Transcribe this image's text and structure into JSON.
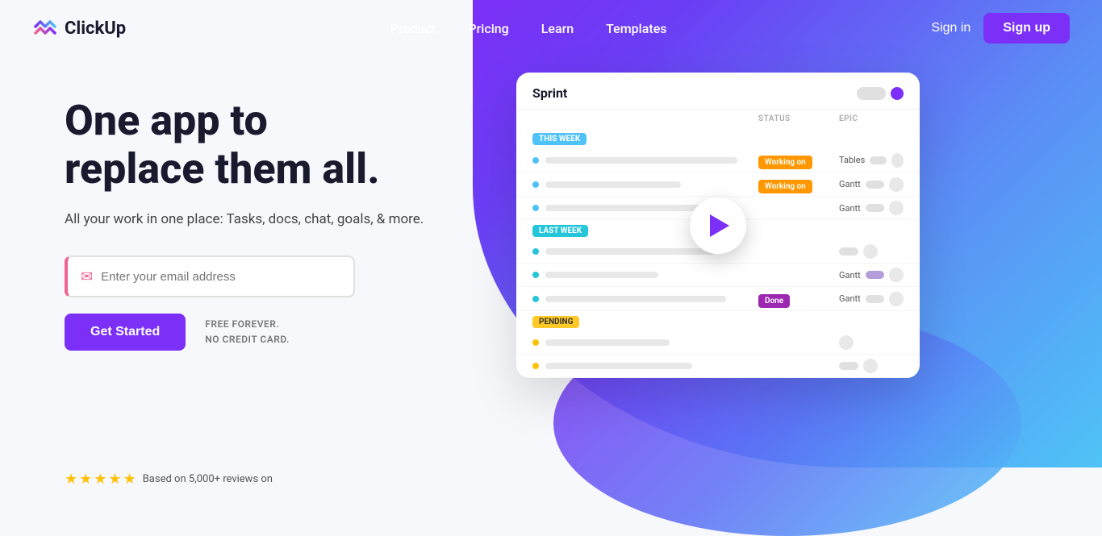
{
  "logo": {
    "text": "ClickUp"
  },
  "nav": {
    "links": [
      {
        "label": "Product",
        "id": "product"
      },
      {
        "label": "Pricing",
        "id": "pricing"
      },
      {
        "label": "Learn",
        "id": "learn"
      },
      {
        "label": "Templates",
        "id": "templates"
      }
    ],
    "sign_in": "Sign in",
    "sign_up": "Sign up"
  },
  "hero": {
    "title_line1": "One app to",
    "title_line2": "replace them all.",
    "subtitle": "All your work in one place: Tasks, docs, chat, goals, & more.",
    "email_placeholder": "Enter your email address",
    "cta_button": "Get Started",
    "free_text_line1": "FREE FOREVER.",
    "free_text_line2": "NO CREDIT CARD."
  },
  "dashboard": {
    "title": "Sprint",
    "col_status": "STATUS",
    "col_epic": "EPIC",
    "sections": [
      {
        "label": "THIS WEEK",
        "class": "label-this-week",
        "tasks": [
          {
            "dot_color": "#4fc3f7",
            "bar_width": "85%",
            "status": "Working on",
            "status_class": "status-working",
            "epic": "Tables"
          },
          {
            "dot_color": "#4fc3f7",
            "bar_width": "60%",
            "status": "Working on",
            "status_class": "status-working",
            "epic": "Gantt"
          },
          {
            "dot_color": "#4fc3f7",
            "bar_width": "70%",
            "status": "",
            "epic": "Gantt"
          }
        ]
      },
      {
        "label": "LAST WEEK",
        "class": "label-last-week",
        "tasks": [
          {
            "dot_color": "#26c6da",
            "bar_width": "75%",
            "status": "",
            "epic": ""
          },
          {
            "dot_color": "#26c6da",
            "bar_width": "50%",
            "status": "",
            "epic": "Gantt"
          },
          {
            "dot_color": "#26c6da",
            "bar_width": "80%",
            "status": "Done",
            "status_class": "status-done",
            "epic": "Gantt"
          }
        ]
      },
      {
        "label": "PENDING",
        "class": "label-pending",
        "tasks": [
          {
            "dot_color": "#ffc107",
            "bar_width": "55%",
            "status": "",
            "epic": ""
          },
          {
            "dot_color": "#ffc107",
            "bar_width": "65%",
            "status": "",
            "epic": ""
          }
        ]
      }
    ]
  },
  "rating": {
    "stars": 5,
    "text": "Based on 5,000+ reviews on"
  }
}
